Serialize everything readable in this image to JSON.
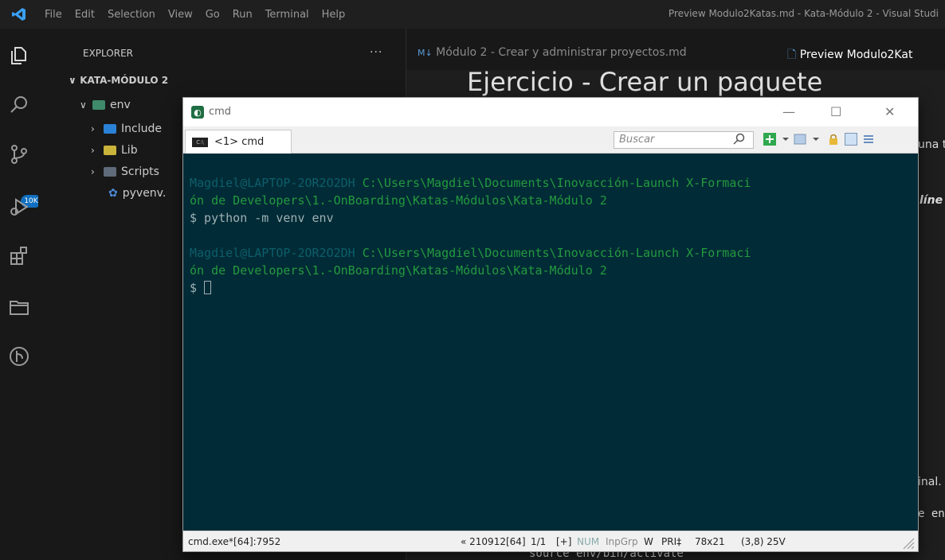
{
  "menubar": {
    "items": [
      "File",
      "Edit",
      "Selection",
      "View",
      "Go",
      "Run",
      "Terminal",
      "Help"
    ],
    "window_title": "Preview Modulo2Katas.md - Kata-Módulo 2 - Visual Studi"
  },
  "activitybar": {
    "badge": "10K"
  },
  "explorer": {
    "header": "EXPLORER",
    "more": "···",
    "root": "KATA-MÓDULO 2",
    "items": [
      {
        "label": "env",
        "expanded": true
      },
      {
        "label": "Include"
      },
      {
        "label": "Lib"
      },
      {
        "label": "Scripts"
      },
      {
        "label": "pyvenv."
      }
    ]
  },
  "tabs": [
    {
      "label": "Módulo 2 - Crear y administrar proyectos.md",
      "prefix": "M↓"
    },
    {
      "label": "Preview Modulo2Kat"
    }
  ],
  "preview": {
    "heading": "Ejercicio - Crear un paquete",
    "fragments": [
      "una t",
      "líne",
      "inal.",
      "e en"
    ],
    "bottom_code": "source env/bin/activate"
  },
  "cmd": {
    "title": "cmd",
    "tab_label": "<1> cmd",
    "tab_icon_text": "C:\\",
    "search_placeholder": "Buscar",
    "minimize": "—",
    "maximize": "☐",
    "close": "✕",
    "console": {
      "prompt1_user": "Magdiel@LAPTOP-2OR2O2DH",
      "prompt1_path_a": "C:\\Users\\Magdiel\\Documents\\Inovacción-Launch X-Formaci",
      "prompt1_path_b": "ón de Developers\\1.-OnBoarding\\Katas-Módulos\\Kata-Módulo 2",
      "command1": "$ python -m venv env",
      "prompt2_user": "Magdiel@LAPTOP-2OR2O2DH",
      "prompt2_path_a": "C:\\Users\\Magdiel\\Documents\\Inovacción-Launch X-Formaci",
      "prompt2_path_b": "ón de Developers\\1.-OnBoarding\\Katas-Módulos\\Kata-Módulo 2",
      "prompt2": "$ "
    },
    "status": {
      "process": "cmd.exe*[64]:7952",
      "build": "« 210912[64]",
      "pos": "1/1",
      "plus": "[+]",
      "num": "NUM",
      "inpgrp": "InpGrp",
      "w": "W",
      "pri": "PRI‡",
      "size": "78x21",
      "cursor": "(3,8) 25V"
    }
  },
  "colors": {
    "console_bg": "#012b36",
    "console_user": "#0c5e6b",
    "console_path": "#249a3f",
    "vs_accent": "#3aa0f3",
    "badge": "#0f6ebf"
  }
}
